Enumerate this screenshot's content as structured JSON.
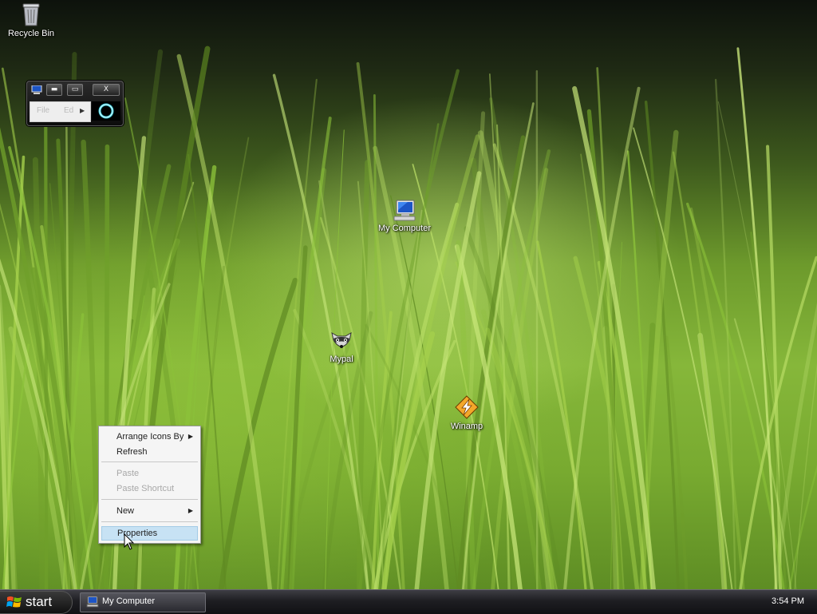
{
  "desktop": {
    "icons": [
      {
        "label": "Recycle Bin",
        "icon": "recycle-bin-icon"
      },
      {
        "label": "My Computer",
        "icon": "computer-icon"
      },
      {
        "label": "Mypal",
        "icon": "mypal-raccoon-icon"
      },
      {
        "label": "Winamp",
        "icon": "winamp-icon"
      }
    ],
    "mini_window": {
      "menu_items": [
        "File",
        "Ed"
      ],
      "buttons": [
        "minimize",
        "maximize",
        "close"
      ],
      "close_label": "X"
    }
  },
  "context_menu": {
    "items": [
      {
        "label": "Arrange Icons By",
        "submenu": true,
        "enabled": true
      },
      {
        "label": "Refresh",
        "submenu": false,
        "enabled": true
      },
      {
        "label": "Paste",
        "submenu": false,
        "enabled": false
      },
      {
        "label": "Paste Shortcut",
        "submenu": false,
        "enabled": false
      },
      {
        "label": "New",
        "submenu": true,
        "enabled": true
      },
      {
        "label": "Properties",
        "submenu": false,
        "enabled": true,
        "highlighted": true
      }
    ],
    "submenu_glyph": "▶"
  },
  "taskbar": {
    "start_label": "start",
    "tasks": [
      {
        "label": "My Computer",
        "icon": "computer-icon"
      }
    ],
    "clock": "3:54 PM"
  },
  "colors": {
    "menu_highlight": "#c7e2f4",
    "taskbar": "#1e1e22",
    "grass_light": "#a6d14c"
  }
}
